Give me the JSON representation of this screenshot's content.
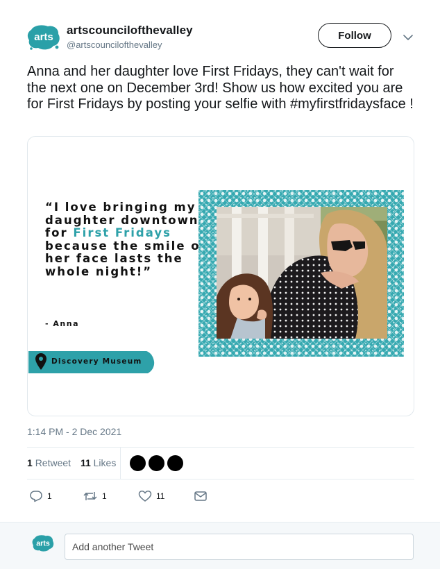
{
  "author": {
    "avatar_text": "arts",
    "name": "artscouncilofthevalley",
    "handle": "@artscouncilofthevalley"
  },
  "follow_label": "Follow",
  "tweet_text": "Anna and her daughter love First Fridays, they can't wait for the next one on December 3rd! Show us how excited you are for First Fridays by posting your selfie with #myfirstfridaysface !",
  "card": {
    "quote_before": "“I love bringing my daughter downtown for",
    "quote_highlight": "First Fridays",
    "quote_after": "because the smile on her face lasts the whole night!”",
    "attribution": "- Anna",
    "location": "Discovery Museum",
    "accent_color": "#2ea1a9"
  },
  "timestamp": "1:14 PM - 2 Dec 2021",
  "stats": {
    "retweets_count": "1",
    "retweets_label": "Retweet",
    "likes_count": "11",
    "likes_label": "Likes"
  },
  "actions": {
    "reply_count": "1",
    "retweet_count": "1",
    "like_count": "11"
  },
  "reply": {
    "placeholder": "Add another Tweet"
  },
  "icons": [
    "chevron-down-icon",
    "location-pin-icon",
    "reply-icon",
    "retweet-icon",
    "heart-icon",
    "mail-icon"
  ]
}
